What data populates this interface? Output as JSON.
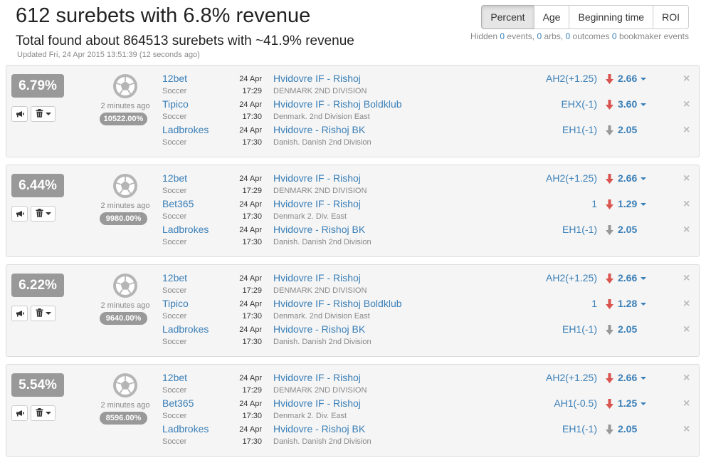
{
  "header": {
    "title": "612 surebets with 6.8% revenue",
    "subtitle": "Total found about 864513 surebets with ~41.9% revenue",
    "updated": "Updated Fri, 24 Apr 2015 13:51:39 (12 seconds ago)",
    "sort_buttons": [
      "Percent",
      "Age",
      "Beginning time",
      "ROI"
    ],
    "active_sort": "Percent",
    "hidden": {
      "prefix": "Hidden",
      "events_count": "0",
      "events_label": "events,",
      "arbs_count": "0",
      "arbs_label": "arbs,",
      "outcomes_count": "0",
      "outcomes_label": "outcomes",
      "bookmaker_count": "0",
      "bookmaker_label": "bookmaker events"
    }
  },
  "colors": {
    "link": "#3a7fb7",
    "down_arrow": "#d9534f",
    "flat_arrow": "#999999",
    "badge": "#999999"
  },
  "surebets": [
    {
      "percent": "6.79%",
      "age": "2 minutes ago",
      "roi": "10522.00%",
      "rows": [
        {
          "bookmaker": "12bet",
          "sport": "Soccer",
          "date": "24 Apr",
          "time": "17:29",
          "event": "Hvidovre IF - Rishoj",
          "league": "DENMARK 2ND DIVISION",
          "market": "AH2(+1.25)",
          "odds": "2.66",
          "trend": "down",
          "caret": true
        },
        {
          "bookmaker": "Tipico",
          "sport": "Soccer",
          "date": "24 Apr",
          "time": "17:30",
          "event": "Hvidovre IF - Rishoj Boldklub",
          "league": "Denmark. 2nd Division East",
          "market": "EHX(-1)",
          "odds": "3.60",
          "trend": "down",
          "caret": true
        },
        {
          "bookmaker": "Ladbrokes",
          "sport": "Soccer",
          "date": "24 Apr",
          "time": "17:30",
          "event": "Hvidovre - Rishoj BK",
          "league": "Danish. Danish 2nd Division",
          "market": "EH1(-1)",
          "odds": "2.05",
          "trend": "flat",
          "caret": false
        }
      ]
    },
    {
      "percent": "6.44%",
      "age": "2 minutes ago",
      "roi": "9980.00%",
      "rows": [
        {
          "bookmaker": "12bet",
          "sport": "Soccer",
          "date": "24 Apr",
          "time": "17:29",
          "event": "Hvidovre IF - Rishoj",
          "league": "DENMARK 2ND DIVISION",
          "market": "AH2(+1.25)",
          "odds": "2.66",
          "trend": "down",
          "caret": true
        },
        {
          "bookmaker": "Bet365",
          "sport": "Soccer",
          "date": "24 Apr",
          "time": "17:30",
          "event": "Hvidovre IF - Rishoj",
          "league": "Denmark 2. Div. East",
          "market": "1",
          "odds": "1.29",
          "trend": "down",
          "caret": true
        },
        {
          "bookmaker": "Ladbrokes",
          "sport": "Soccer",
          "date": "24 Apr",
          "time": "17:30",
          "event": "Hvidovre - Rishoj BK",
          "league": "Danish. Danish 2nd Division",
          "market": "EH1(-1)",
          "odds": "2.05",
          "trend": "flat",
          "caret": false
        }
      ]
    },
    {
      "percent": "6.22%",
      "age": "2 minutes ago",
      "roi": "9640.00%",
      "rows": [
        {
          "bookmaker": "12bet",
          "sport": "Soccer",
          "date": "24 Apr",
          "time": "17:29",
          "event": "Hvidovre IF - Rishoj",
          "league": "DENMARK 2ND DIVISION",
          "market": "AH2(+1.25)",
          "odds": "2.66",
          "trend": "down",
          "caret": true
        },
        {
          "bookmaker": "Tipico",
          "sport": "Soccer",
          "date": "24 Apr",
          "time": "17:30",
          "event": "Hvidovre IF - Rishoj Boldklub",
          "league": "Denmark. 2nd Division East",
          "market": "1",
          "odds": "1.28",
          "trend": "down",
          "caret": true
        },
        {
          "bookmaker": "Ladbrokes",
          "sport": "Soccer",
          "date": "24 Apr",
          "time": "17:30",
          "event": "Hvidovre - Rishoj BK",
          "league": "Danish. Danish 2nd Division",
          "market": "EH1(-1)",
          "odds": "2.05",
          "trend": "flat",
          "caret": false
        }
      ]
    },
    {
      "percent": "5.54%",
      "age": "2 minutes ago",
      "roi": "8596.00%",
      "rows": [
        {
          "bookmaker": "12bet",
          "sport": "Soccer",
          "date": "24 Apr",
          "time": "17:29",
          "event": "Hvidovre IF - Rishoj",
          "league": "DENMARK 2ND DIVISION",
          "market": "AH2(+1.25)",
          "odds": "2.66",
          "trend": "down",
          "caret": true
        },
        {
          "bookmaker": "Bet365",
          "sport": "Soccer",
          "date": "24 Apr",
          "time": "17:30",
          "event": "Hvidovre IF - Rishoj",
          "league": "Denmark 2. Div. East",
          "market": "AH1(-0.5)",
          "odds": "1.25",
          "trend": "down",
          "caret": true
        },
        {
          "bookmaker": "Ladbrokes",
          "sport": "Soccer",
          "date": "24 Apr",
          "time": "17:30",
          "event": "Hvidovre - Rishoj BK",
          "league": "Danish. Danish 2nd Division",
          "market": "EH1(-1)",
          "odds": "2.05",
          "trend": "flat",
          "caret": false
        }
      ]
    }
  ]
}
